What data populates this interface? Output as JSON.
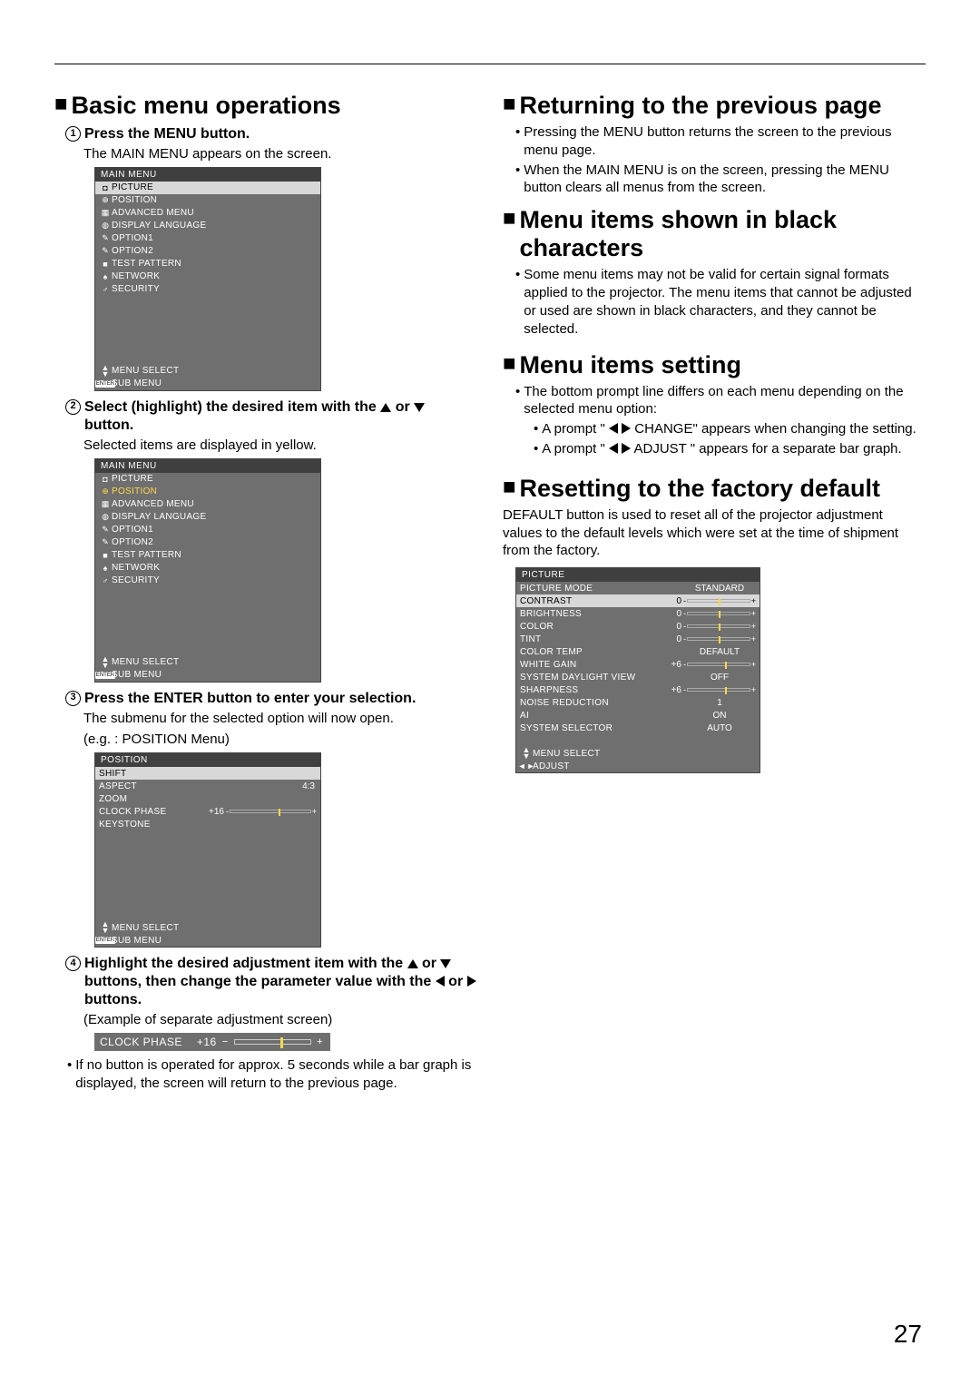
{
  "page_number": "27",
  "left": {
    "heading": "Basic menu operations",
    "step1": {
      "num": "1",
      "title": "Press the MENU button.",
      "body": "The MAIN MENU appears on the screen.",
      "osd_title": "MAIN MENU",
      "items": [
        "PICTURE",
        "POSITION",
        "ADVANCED MENU",
        "DISPLAY LANGUAGE",
        "OPTION1",
        "OPTION2",
        "TEST PATTERN",
        "NETWORK",
        "SECURITY"
      ],
      "footer1": "MENU SELECT",
      "footer2": "SUB MENU"
    },
    "step2": {
      "num": "2",
      "title_a": "Select (highlight) the desired item with the ",
      "title_b": " or ",
      "title_c": " button.",
      "body": "Selected items are displayed in yellow.",
      "osd_title": "MAIN MENU",
      "items": [
        "PICTURE",
        "POSITION",
        "ADVANCED MENU",
        "DISPLAY LANGUAGE",
        "OPTION1",
        "OPTION2",
        "TEST PATTERN",
        "NETWORK",
        "SECURITY"
      ],
      "footer1": "MENU SELECT",
      "footer2": "SUB MENU"
    },
    "step3": {
      "num": "3",
      "title": "Press the ENTER button to enter your selection.",
      "body1": "The submenu for the selected option will now open.",
      "body2": "(e.g. : POSITION Menu)",
      "osd_title": "POSITION",
      "rows": [
        {
          "label": "SHIFT"
        },
        {
          "label": "ASPECT",
          "val": "4:3"
        },
        {
          "label": "ZOOM"
        },
        {
          "label": "CLOCK PHASE",
          "val": "+16",
          "bar": true,
          "tick": 60
        },
        {
          "label": "KEYSTONE"
        }
      ],
      "footer1": "MENU SELECT",
      "footer2": "SUB MENU"
    },
    "step4": {
      "num": "4",
      "title_a": "Highlight the desired adjustment item with the ",
      "title_b": " or ",
      "title_c": " buttons, then change the parameter value with the ",
      "title_d": " or ",
      "title_e": " buttons.",
      "body": "(Example of separate adjustment screen)",
      "adj_label": "CLOCK PHASE",
      "adj_val": "+16",
      "note": "If no button is operated for approx. 5 seconds while a bar graph is displayed, the screen will return to the previous page."
    }
  },
  "right": {
    "h_return": "Returning to the previous page",
    "return_b1": "Pressing the MENU button returns the screen to the previous menu page.",
    "return_b2": "When the MAIN MENU is on the screen, pressing the MENU button clears all menus from the screen.",
    "h_black": "Menu items shown in black characters",
    "black_b1": "Some menu items may not be valid for certain signal formats applied to the projector. The menu items that cannot be adjusted or used are shown in black characters, and they cannot be selected.",
    "h_setting": "Menu items setting",
    "setting_b0": "The bottom prompt line differs on each menu depending on the selected menu option:",
    "setting_b1a": "A prompt \" ",
    "setting_b1b": " CHANGE\" appears when changing the setting.",
    "setting_b2a": "A prompt \" ",
    "setting_b2b": " ADJUST  \" appears for a separate bar graph.",
    "h_reset": "Resetting to the factory default",
    "reset_body": "DEFAULT button is used to reset all of the projector adjustment values to the default levels which were set at the time of shipment from the factory.",
    "picture": {
      "title": "PICTURE",
      "rows": [
        {
          "label": "PICTURE MODE",
          "val": "STANDARD"
        },
        {
          "label": "CONTRAST",
          "val": "0",
          "bar": true,
          "sel": true,
          "tick": 50
        },
        {
          "label": "BRIGHTNESS",
          "val": "0",
          "bar": true,
          "tick": 50
        },
        {
          "label": "COLOR",
          "val": "0",
          "bar": true,
          "tick": 50
        },
        {
          "label": "TINT",
          "val": "0",
          "bar": true,
          "tick": 50
        },
        {
          "label": "COLOR TEMP",
          "val": "DEFAULT"
        },
        {
          "label": "WHITE GAIN",
          "val": "+6",
          "bar": true,
          "tick": 60
        },
        {
          "label": "SYSTEM DAYLIGHT VIEW",
          "val": "OFF"
        },
        {
          "label": "SHARPNESS",
          "val": "+6",
          "bar": true,
          "tick": 60
        },
        {
          "label": "NOISE REDUCTION",
          "val": "1"
        },
        {
          "label": "AI",
          "val": "ON"
        },
        {
          "label": "SYSTEM SELECTOR",
          "val": "AUTO"
        }
      ],
      "footer1": "MENU SELECT",
      "footer2": "ADJUST"
    }
  }
}
